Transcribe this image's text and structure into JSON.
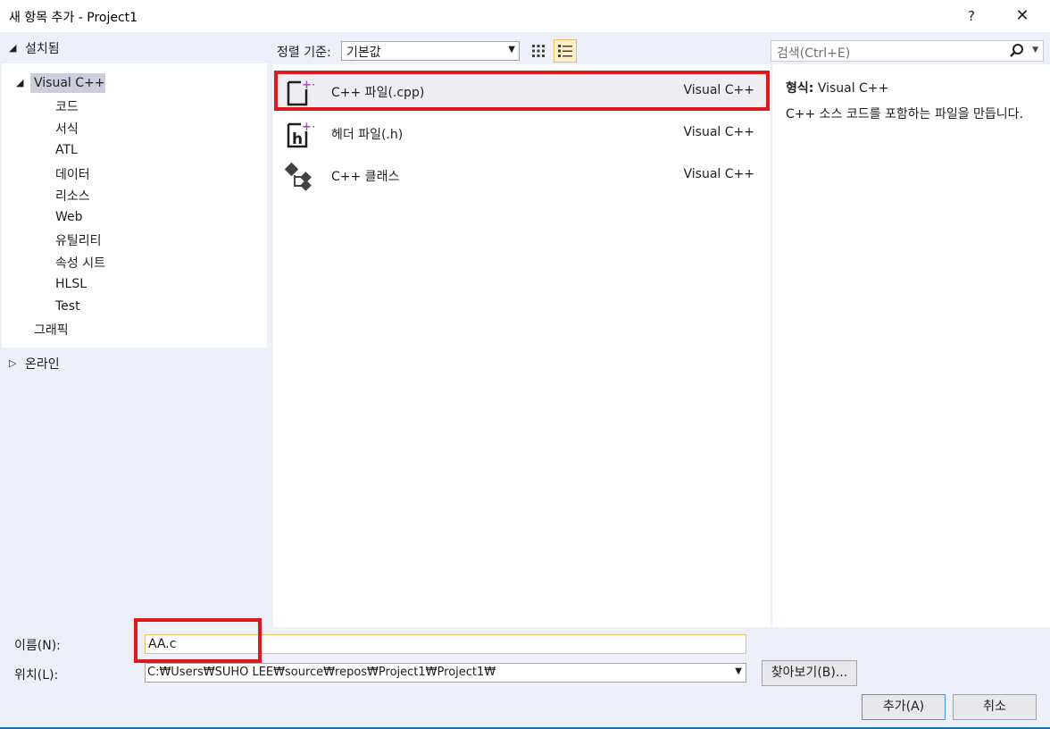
{
  "window": {
    "title": "새 항목 추가 - Project1",
    "help_label": "?",
    "close_label": "✕"
  },
  "tree": {
    "installed_label": "설치됨",
    "items": [
      {
        "label": "Visual C++"
      },
      {
        "label": "코드"
      },
      {
        "label": "서식"
      },
      {
        "label": "ATL"
      },
      {
        "label": "데이터"
      },
      {
        "label": "리소스"
      },
      {
        "label": "Web"
      },
      {
        "label": "유틸리티"
      },
      {
        "label": "속성 시트"
      },
      {
        "label": "HLSL"
      },
      {
        "label": "Test"
      },
      {
        "label": "그래픽"
      }
    ],
    "online_label": "온라인"
  },
  "toolbar": {
    "sort_label": "정렬 기준:",
    "sort_value": "기본값",
    "search_placeholder": "검색(Ctrl+E)"
  },
  "templates": [
    {
      "name": "C++ 파일(.cpp)",
      "type": "Visual C++",
      "icon": "cpp-file-icon"
    },
    {
      "name": "헤더 파일(.h)",
      "type": "Visual C++",
      "icon": "header-file-icon"
    },
    {
      "name": "C++ 클래스",
      "type": "Visual C++",
      "icon": "cpp-class-icon"
    }
  ],
  "info": {
    "type_label": "형식:",
    "type_value": "Visual C++",
    "description": "C++ 소스 코드를 포함하는 파일을 만듭니다."
  },
  "form": {
    "name_label": "이름(N):",
    "name_value": "AA.c",
    "location_label": "위치(L):",
    "location_value": "C:₩Users₩SUHO LEE₩source₩repos₩Project1₩Project1₩",
    "browse_label": "찾아보기(B)...",
    "add_label": "추가(A)",
    "cancel_label": "취소"
  },
  "colors": {
    "highlight_red": "#e0191e",
    "dialog_bg": "#eef0f9",
    "selection": "#cccedb",
    "icon_purple": "#a54dbd"
  }
}
